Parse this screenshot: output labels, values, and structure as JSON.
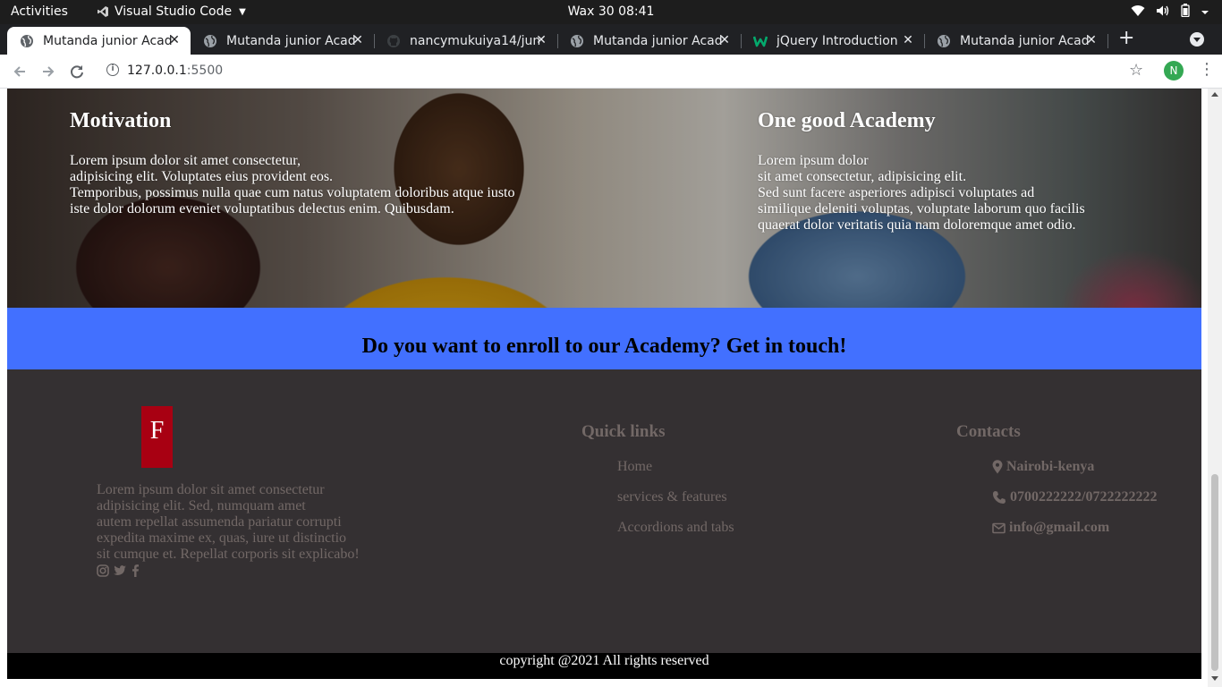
{
  "system": {
    "activities": "Activities",
    "app_name": "Visual Studio Code",
    "clock": "Wax 30  08:41"
  },
  "browser": {
    "tabs": [
      {
        "title": "Mutanda junior Acad",
        "icon": "globe-icon"
      },
      {
        "title": "Mutanda junior Acad",
        "icon": "globe-icon"
      },
      {
        "title": "nancymukuiya14/jun",
        "icon": "github-icon"
      },
      {
        "title": "Mutanda junior Acad",
        "icon": "globe-icon"
      },
      {
        "title": "jQuery Introduction",
        "icon": "w3schools-icon"
      },
      {
        "title": "Mutanda junior Acad",
        "icon": "globe-icon"
      }
    ],
    "url_host": "127.0.0.1",
    "url_port": ":5500",
    "profile_initial": "N"
  },
  "hero": {
    "left": {
      "title": "Motivation",
      "text": "Lorem ipsum dolor sit amet consectetur,\nadipisicing elit. Voluptates eius provident eos.\nTemporibus, possimus nulla quae cum natus voluptatem doloribus atque iusto\niste dolor dolorum eveniet voluptatibus delectus enim. Quibusdam."
    },
    "right": {
      "title": "One good Academy",
      "text": "Lorem ipsum dolor\nsit amet consectetur, adipisicing elit.\nSed sunt facere asperiores adipisci voluptates ad\nsimilique deleniti voluptas, voluptate laborum quo facilis\nquaerat dolor veritatis quia nam doloremque amet odio."
    }
  },
  "cta": {
    "text": "Do you want to enroll to our Academy? Get in touch!",
    "color": "#4270ff"
  },
  "footer": {
    "logo_letter": "F",
    "about": "Lorem ipsum dolor sit amet consectetur\nadipisicing elit. Sed, numquam amet\nautem repellat assumenda pariatur corrupti\nexpedita maxime ex, quas, iure ut distinctio\nsit cumque et. Repellat corporis sit explicabo!",
    "socials": [
      "instagram-icon",
      "twitter-icon",
      "facebook-icon"
    ],
    "quick_links": {
      "heading": "Quick links",
      "items": [
        "Home",
        "services & features",
        "Accordions and tabs"
      ]
    },
    "contacts": {
      "heading": "Contacts",
      "location": "Nairobi-kenya",
      "phone": "0700222222/0722222222",
      "email": "info@gmail.com"
    },
    "copyright": "copyright @2021 All rights reserved"
  }
}
